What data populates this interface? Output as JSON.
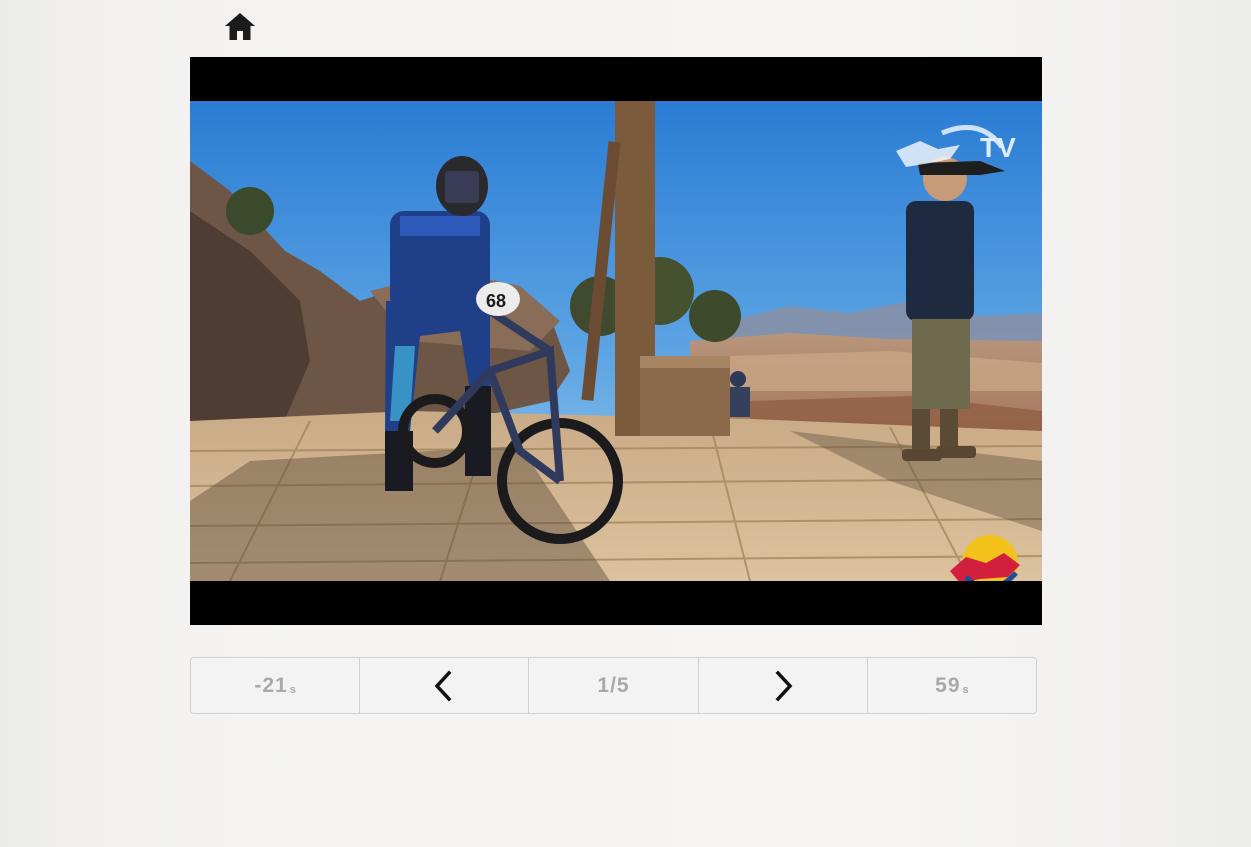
{
  "header": {
    "home_icon": "home-icon"
  },
  "video": {
    "watermark_top": "TV",
    "logos": [
      "redbull-tv-logo",
      "redbull-logo"
    ]
  },
  "controls": {
    "skip_back": {
      "value": "-21",
      "unit": "s"
    },
    "prev_icon": "chevron-left-icon",
    "page_indicator": "1/5",
    "next_icon": "chevron-right-icon",
    "skip_forward": {
      "value": "59",
      "unit": "s"
    }
  }
}
